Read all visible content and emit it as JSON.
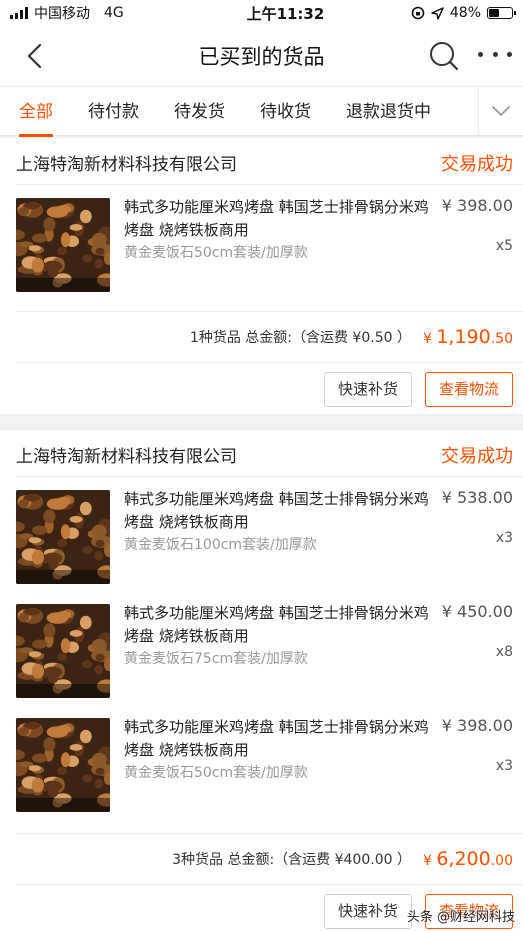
{
  "status_bar": {
    "carrier": "中国移动",
    "network": "4G",
    "time": "上午11:32",
    "battery_percent": "48%",
    "battery_level": 0.48
  },
  "nav": {
    "title": "已买到的货品",
    "back_icon": "chevron-left-icon",
    "search_icon": "search-icon",
    "more_icon": "more-dots-icon"
  },
  "tabs": [
    "全部",
    "待付款",
    "待发货",
    "待收货",
    "退款退货中"
  ],
  "tabs_active": "全部",
  "tab_dropdown_icon": "chevron-down-icon",
  "accent_color": "#ff5000",
  "orders": [
    {
      "shop": "上海特淘新材料科技有限公司",
      "status": "交易成功",
      "items": [
        {
          "title": "韩式多功能厘米鸡烤盘 韩国芝士排骨锅分米鸡烤盘 烧烤铁板商用",
          "spec": "黄金麦饭石50cm套装/加厚款",
          "price": "¥ 398.00",
          "qty": "x5"
        }
      ],
      "summary_text": "1种货品 总金额:（含运费 ¥0.50 ）",
      "total_symbol": "¥ ",
      "total_int": "1,190",
      "total_dec": ".50",
      "buttons": [
        "快速补货",
        "查看物流"
      ]
    },
    {
      "shop": "上海特淘新材料科技有限公司",
      "status": "交易成功",
      "items": [
        {
          "title": "韩式多功能厘米鸡烤盘 韩国芝士排骨锅分米鸡烤盘 烧烤铁板商用",
          "spec": "黄金麦饭石100cm套装/加厚款",
          "price": "¥ 538.00",
          "qty": "x3"
        },
        {
          "title": "韩式多功能厘米鸡烤盘 韩国芝士排骨锅分米鸡烤盘 烧烤铁板商用",
          "spec": "黄金麦饭石75cm套装/加厚款",
          "price": "¥ 450.00",
          "qty": "x8"
        },
        {
          "title": "韩式多功能厘米鸡烤盘 韩国芝士排骨锅分米鸡烤盘 烧烤铁板商用",
          "spec": "黄金麦饭石50cm套装/加厚款",
          "price": "¥ 398.00",
          "qty": "x3"
        }
      ],
      "summary_text": "3种货品 总金额:（含运费 ¥400.00 ）",
      "total_symbol": "¥ ",
      "total_int": "6,200",
      "total_dec": ".00",
      "buttons": [
        "快速补货",
        "查看物流"
      ]
    }
  ],
  "watermark": "头条 @财经网科技"
}
